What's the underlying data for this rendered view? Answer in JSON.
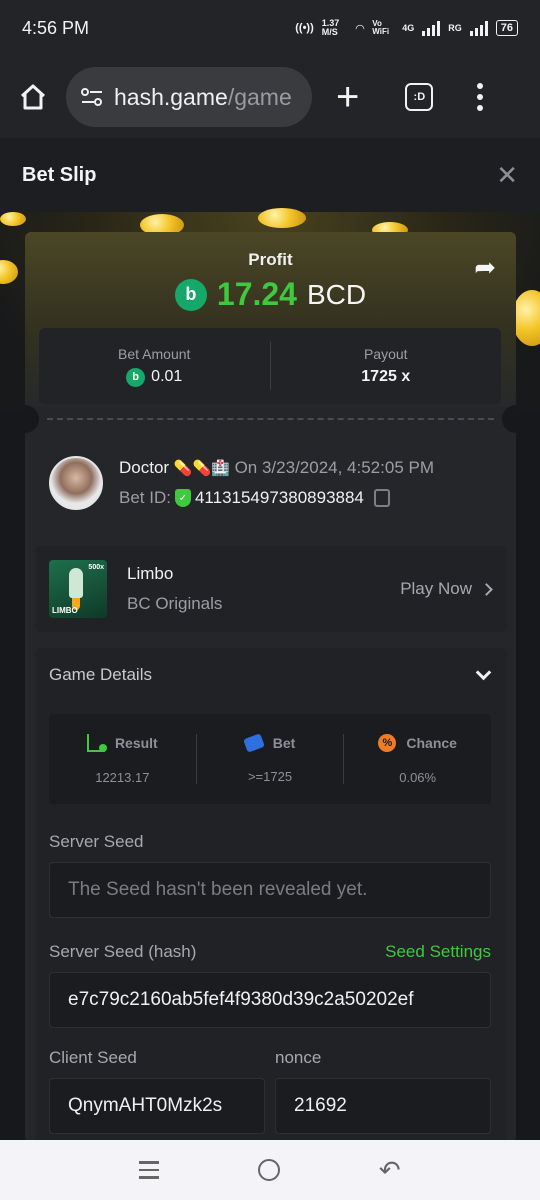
{
  "status_bar": {
    "time": "4:56 PM",
    "speed": "1.37 M/S",
    "vowifi": "Vo WiFi",
    "net1": "4G",
    "net2": "RG",
    "battery": "76"
  },
  "browser": {
    "url_host": "hash.game",
    "url_path": "/game",
    "tab_label": ":D"
  },
  "header": {
    "title": "Bet Slip"
  },
  "profit": {
    "label": "Profit",
    "value": "17.24",
    "unit": "BCD"
  },
  "amounts": {
    "bet_label": "Bet Amount",
    "bet_value": "0.01",
    "payout_label": "Payout",
    "payout_value": "1725 x"
  },
  "user": {
    "name": "Doctor",
    "emoji": "💊💊🏥",
    "date": "On 3/23/2024, 4:52:05 PM",
    "bet_id_label": "Bet ID:",
    "bet_id": "411315497380893884"
  },
  "game": {
    "name": "Limbo",
    "provider": "BC Originals",
    "play_label": "Play Now",
    "thumb_tag": "LIMBO",
    "thumb_mult": "500x"
  },
  "details": {
    "title": "Game Details",
    "stats": [
      {
        "label": "Result",
        "value": "12213.17"
      },
      {
        "label": "Bet",
        "value": ">=1725"
      },
      {
        "label": "Chance",
        "value": "0.06%"
      }
    ],
    "server_seed_label": "Server Seed",
    "server_seed_placeholder": "The Seed hasn't been revealed yet.",
    "server_hash_label": "Server Seed (hash)",
    "seed_settings_label": "Seed Settings",
    "server_hash_value": "e7c79c2160ab5fef4f9380d39c2a50202ef",
    "client_seed_label": "Client Seed",
    "client_seed_value": "QnymAHT0Mzk2s",
    "nonce_label": "nonce",
    "nonce_value": "21692"
  },
  "colors": {
    "accent_green": "#3ec93e",
    "bc_green": "#16a76b",
    "bet_blue": "#2f6fe0",
    "chance_orange": "#ef7b25"
  }
}
